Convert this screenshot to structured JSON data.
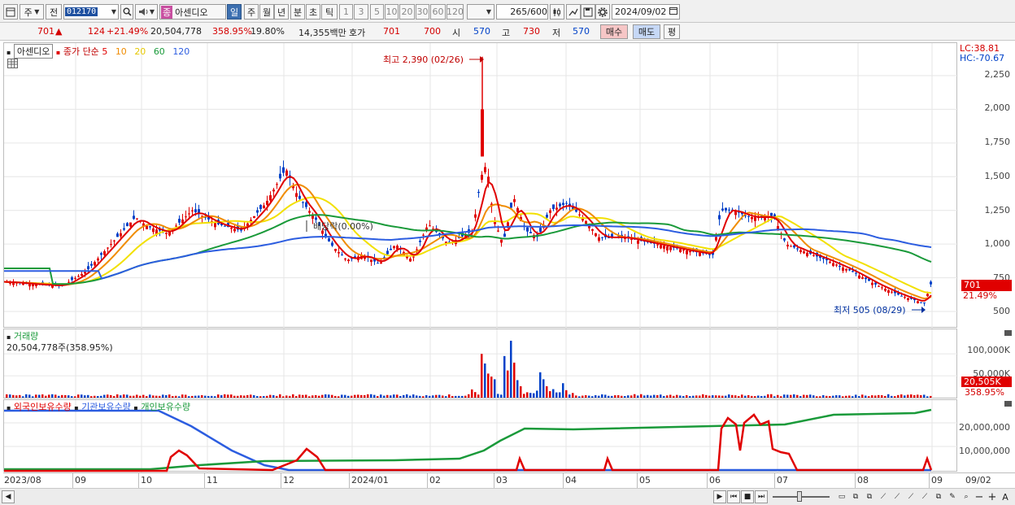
{
  "toolbar": {
    "chart_menu_icon": "chart-menu-icon",
    "market_label": "주",
    "prev_label": "전",
    "code_value": "012170",
    "search_icon": "search-icon",
    "speaker_icon": "speaker-icon",
    "stock_badge": "종",
    "stock_name": "아센디오",
    "periods": [
      "일",
      "주",
      "월",
      "년",
      "분",
      "초",
      "틱"
    ],
    "active_period": "일",
    "intervals": [
      "1",
      "3",
      "5",
      "10",
      "20",
      "30",
      "60",
      "120"
    ],
    "count_value": "265",
    "count_max": "/600",
    "date_value": "2024/09/02"
  },
  "quote": {
    "price": "701",
    "change": "124",
    "change_pct": "+21.49%",
    "volume": "20,504,778",
    "volume_ratio": "358.95%",
    "turnover": "19.80%",
    "amount": "14,355백만",
    "hoga_label": "호가",
    "ask": "701",
    "bid": "700",
    "open_label": "시",
    "open": "570",
    "high_label": "고",
    "high": "730",
    "low_label": "저",
    "low": "570",
    "buy_label": "매수",
    "sell_label": "매도",
    "eval_label": "평"
  },
  "price_legend": {
    "name": "아센디오",
    "desc": "종가 단순",
    "ma": [
      "5",
      "10",
      "20",
      "60",
      "120"
    ],
    "ma_colors": [
      "#e00000",
      "#f08c00",
      "#f2e000",
      "#1a9a3a",
      "#2c5de0"
    ]
  },
  "price_axis": {
    "lc": "LC:38.81",
    "hc": "HC:-70.67",
    "ticks": [
      "2,250",
      "2,000",
      "1,750",
      "1,500",
      "1,250",
      "1,000",
      "750",
      "500"
    ],
    "current_price": "701",
    "current_pct": "21.49%"
  },
  "price_annotations": {
    "high": "최고 2,390 (02/26)",
    "low": "최저 505 (08/29)",
    "limit_down": "배당락(0.00%)"
  },
  "volume_legend": {
    "title": "거래량",
    "value": "20,504,778주(358.95%)"
  },
  "volume_axis": {
    "ticks": [
      "100,000K",
      "50,000K"
    ],
    "current": "20,505K",
    "current_pct": "358.95%"
  },
  "holding_legend": {
    "items": [
      "외국인보유수량",
      "기관보유수량",
      "개인보유수량"
    ],
    "colors": [
      "#e00000",
      "#2c5de0",
      "#1a9a3a"
    ]
  },
  "holding_axis": {
    "ticks": [
      "20,000,000",
      "10,000,000"
    ]
  },
  "x_axis": {
    "labels": [
      "2023/08",
      "09",
      "10",
      "11",
      "12",
      "2024/01",
      "02",
      "03",
      "04",
      "05",
      "06",
      "07",
      "08",
      "09",
      "09/02"
    ]
  },
  "colors": {
    "up": "#e00000",
    "down": "#0041c8",
    "ma5": "#e00000",
    "ma10": "#f08c00",
    "ma20": "#f2e000",
    "ma60": "#1a9a3a",
    "ma120": "#2c5de0"
  }
}
